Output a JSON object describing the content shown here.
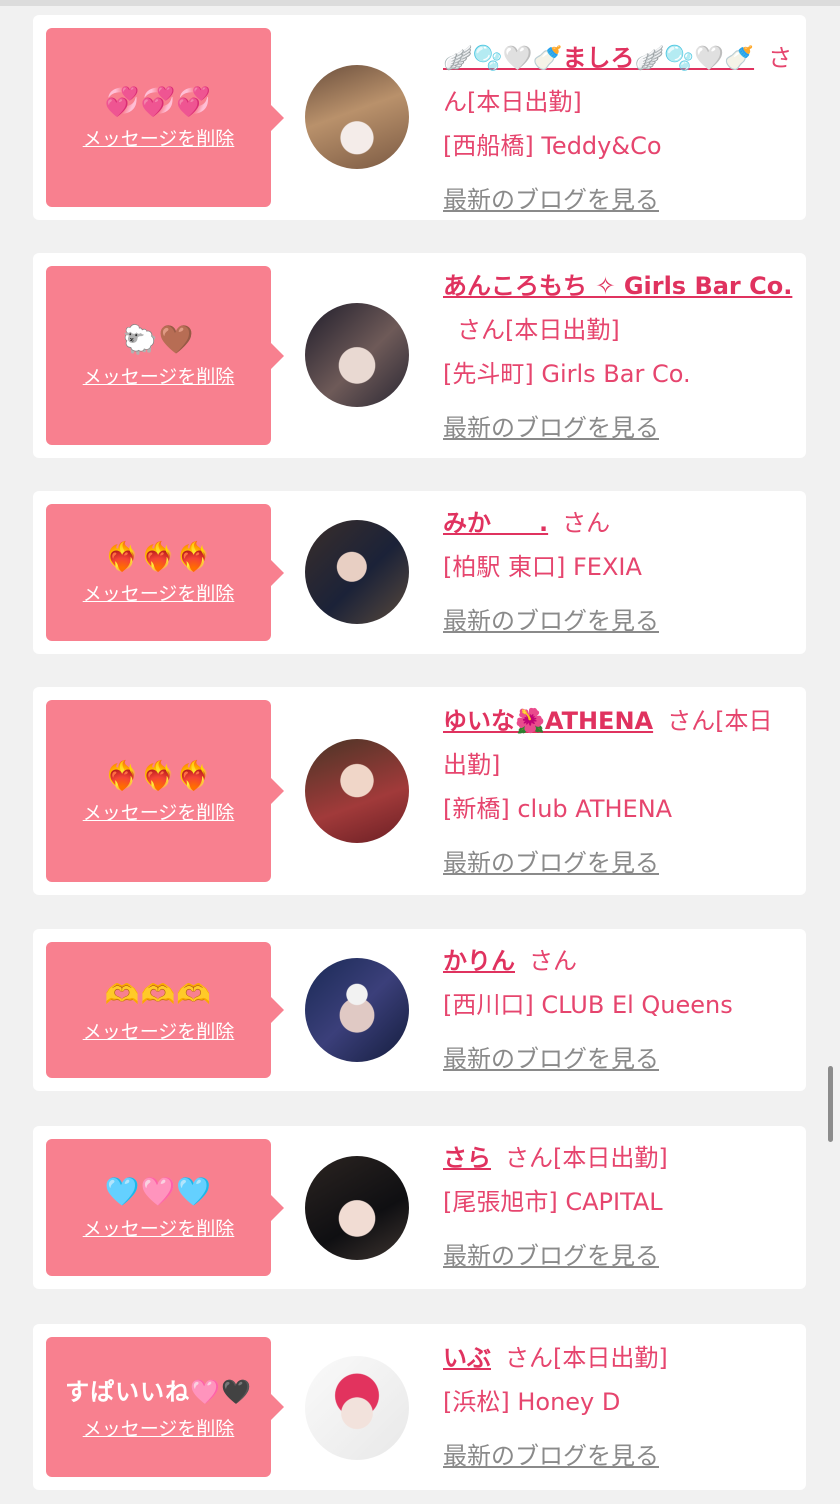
{
  "delete_label": "メッセージを削除",
  "blog_label": "最新のブログを見る",
  "san_label": "さん",
  "colors": {
    "bubble": "#f8808f",
    "link": "#e0325f",
    "muted": "#8a8a8a",
    "background": "#f1f1f1"
  },
  "cards": [
    {
      "message": "💞💞💞",
      "name": "🪽🫧🤍🍼ましろ🪽🫧🤍🍼",
      "status": "[本日出勤]",
      "shop": "[西船橋] Teddy&Co"
    },
    {
      "message": "🐑🤎",
      "name": "あんころもち ✧ Girls Bar Co.",
      "status": "[本日出勤]",
      "shop": "[先斗町] Girls Bar Co."
    },
    {
      "message": "❤️‍🔥❤️‍🔥❤️‍🔥",
      "name": "みか　　.",
      "status": "",
      "shop": "[柏駅 東口] FEXIA"
    },
    {
      "message": "❤️‍🔥❤️‍🔥❤️‍🔥",
      "name": "ゆいな🌺ATHENA",
      "status": "[本日出勤]",
      "shop": "[新橋] club ATHENA"
    },
    {
      "message": "🫶🫶🫶",
      "name": "かりん",
      "status": "",
      "shop": "[西川口] CLUB El Queens"
    },
    {
      "message": "🩵🩷🩵",
      "name": "さら",
      "status": "[本日出勤]",
      "shop": "[尾張旭市] CAPITAL"
    },
    {
      "message": "すぱいいね🩷🖤",
      "name": "いぶ",
      "status": "[本日出勤]",
      "shop": "[浜松] Honey D"
    }
  ]
}
